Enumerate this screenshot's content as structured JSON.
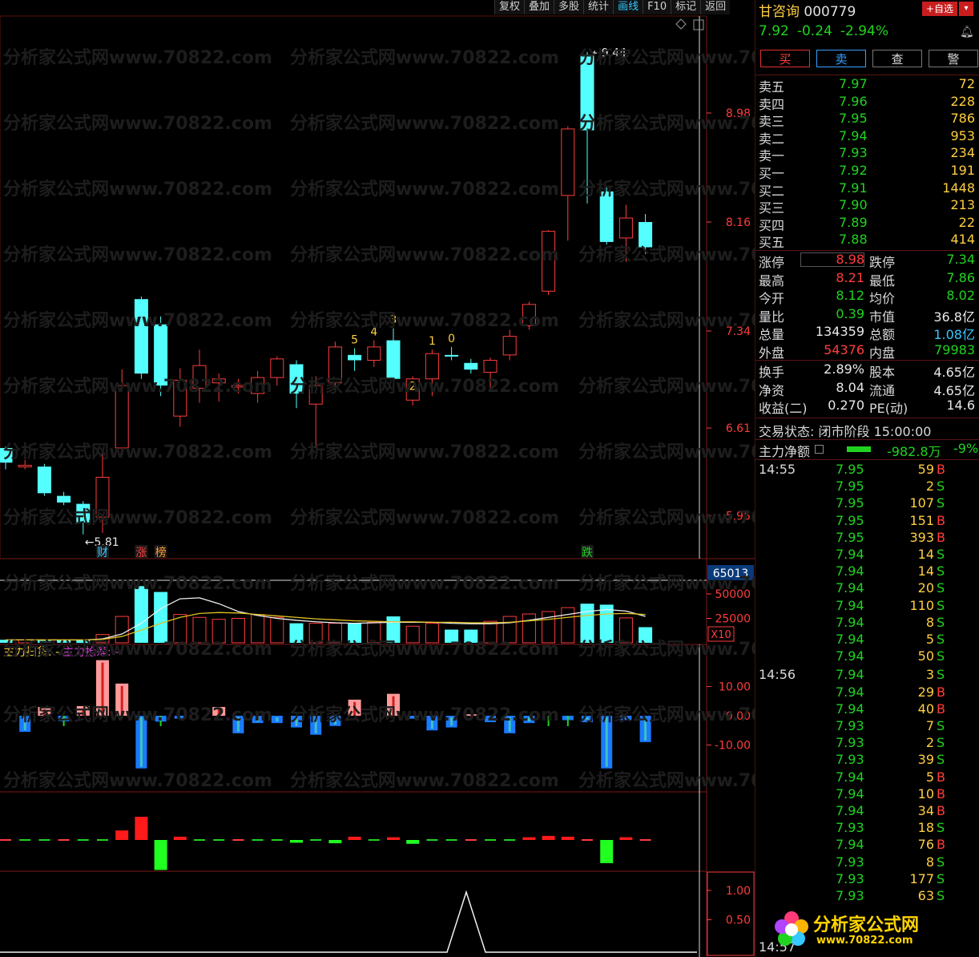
{
  "toolbar": [
    "复权",
    "叠加",
    "多股",
    "统计",
    "画线",
    "F10",
    "标记",
    "返回"
  ],
  "toolbar_active": "画线",
  "watermark": "分析家公式网www.70822.com",
  "chart": {
    "price_axis": [
      "8.98",
      "8.16",
      "7.34",
      "6.61",
      "5.95"
    ],
    "high_marker": "9.44",
    "low_marker": "5.81",
    "candles": [
      {
        "o": 6.46,
        "c": 6.35,
        "h": 6.47,
        "l": 6.3
      },
      {
        "o": 6.33,
        "c": 6.33,
        "h": 6.37,
        "l": 6.3
      },
      {
        "o": 6.32,
        "c": 6.12,
        "h": 6.34,
        "l": 6.1
      },
      {
        "o": 6.1,
        "c": 6.05,
        "h": 6.13,
        "l": 6.03
      },
      {
        "o": 6.04,
        "c": 5.9,
        "h": 6.06,
        "l": 5.81
      },
      {
        "o": 5.94,
        "c": 6.24,
        "h": 6.45,
        "l": 5.82
      },
      {
        "o": 6.46,
        "c": 6.93,
        "h": 7.05,
        "l": 6.4
      },
      {
        "o": 7.58,
        "c": 7.02,
        "h": 7.6,
        "l": 6.98
      },
      {
        "o": 7.39,
        "c": 6.93,
        "h": 7.45,
        "l": 6.85
      },
      {
        "o": 6.7,
        "c": 6.97,
        "h": 7.06,
        "l": 6.62
      },
      {
        "o": 6.91,
        "c": 7.08,
        "h": 7.2,
        "l": 6.8
      },
      {
        "o": 6.95,
        "c": 6.98,
        "h": 7.02,
        "l": 6.81
      },
      {
        "o": 6.92,
        "c": 6.93,
        "h": 6.98,
        "l": 6.87
      },
      {
        "o": 6.87,
        "c": 6.99,
        "h": 7.04,
        "l": 6.8
      },
      {
        "o": 6.99,
        "c": 7.13,
        "h": 7.15,
        "l": 6.93
      },
      {
        "o": 7.09,
        "c": 6.87,
        "h": 7.12,
        "l": 6.76
      },
      {
        "o": 6.79,
        "c": 6.93,
        "h": 7.0,
        "l": 6.46
      },
      {
        "o": 6.95,
        "c": 7.22,
        "h": 7.26,
        "l": 6.9
      },
      {
        "o": 7.16,
        "c": 7.12,
        "h": 7.21,
        "l": 7.04
      },
      {
        "o": 7.12,
        "c": 7.22,
        "h": 7.27,
        "l": 7.07
      },
      {
        "o": 7.27,
        "c": 6.98,
        "h": 7.36,
        "l": 6.91
      },
      {
        "o": 6.82,
        "c": 6.98,
        "h": 7.0,
        "l": 6.78
      },
      {
        "o": 6.98,
        "c": 7.17,
        "h": 7.2,
        "l": 6.85
      },
      {
        "o": 7.16,
        "c": 7.15,
        "h": 7.22,
        "l": 7.12
      },
      {
        "o": 7.1,
        "c": 7.05,
        "h": 7.13,
        "l": 7.02
      },
      {
        "o": 7.03,
        "c": 7.12,
        "h": 7.14,
        "l": 6.91
      },
      {
        "o": 7.16,
        "c": 7.3,
        "h": 7.35,
        "l": 7.12
      },
      {
        "o": 7.38,
        "c": 7.54,
        "h": 7.56,
        "l": 7.35
      },
      {
        "o": 7.64,
        "c": 8.09,
        "h": 8.1,
        "l": 7.61
      },
      {
        "o": 8.36,
        "c": 8.86,
        "h": 8.88,
        "l": 8.02
      },
      {
        "o": 9.42,
        "c": 8.85,
        "h": 9.44,
        "l": 8.3
      },
      {
        "o": 8.39,
        "c": 8.01,
        "h": 8.42,
        "l": 7.99
      },
      {
        "o": 8.04,
        "c": 8.19,
        "h": 8.29,
        "l": 7.86
      },
      {
        "o": 8.16,
        "c": 7.97,
        "h": 8.22,
        "l": 7.92
      }
    ],
    "number_labels": [
      {
        "i": 18,
        "t": "5"
      },
      {
        "i": 19,
        "t": "4"
      },
      {
        "i": 20,
        "t": "3"
      },
      {
        "i": 21,
        "t": "2"
      },
      {
        "i": 22,
        "t": "1"
      },
      {
        "i": 23,
        "t": "0"
      }
    ],
    "event_tags": [
      {
        "i": 5,
        "t": "财",
        "color": "#36c8ff"
      },
      {
        "i": 7,
        "t": "涨",
        "color": "#ff3c3c"
      },
      {
        "i": 8,
        "t": "榜",
        "color": "#ff9a30"
      },
      {
        "i": 30,
        "t": "跌",
        "color": "#21d321"
      }
    ],
    "volume_axis": [
      "50000",
      "25000"
    ],
    "volume_readout": "65013",
    "volume_scale": "X10",
    "volumes": [
      3100,
      3000,
      3000,
      2800,
      2900,
      8500,
      27000,
      58000,
      52000,
      29000,
      26000,
      24000,
      25000,
      29000,
      26000,
      20000,
      20000,
      20000,
      20000,
      21000,
      27000,
      17000,
      20000,
      13500,
      13500,
      22000,
      27000,
      29500,
      32000,
      36000,
      40000,
      39000,
      25500,
      16000
    ],
    "ma1": [
      3000,
      3000,
      3000,
      2900,
      2900,
      4000,
      9000,
      20000,
      35000,
      45000,
      46000,
      40000,
      32000,
      28000,
      25000,
      23000,
      21500,
      20500,
      20000,
      20500,
      21000,
      21000,
      21000,
      20000,
      19500,
      19500,
      20500,
      23000,
      26000,
      29000,
      32000,
      34000,
      32500,
      27000
    ],
    "ma2": [
      3000,
      3000,
      3000,
      3000,
      3000,
      3500,
      6500,
      13000,
      20000,
      26000,
      30000,
      31000,
      30500,
      29000,
      27500,
      26000,
      24500,
      23500,
      22500,
      22000,
      21500,
      21500,
      21000,
      21000,
      20500,
      20500,
      21000,
      22500,
      24000,
      26000,
      28000,
      29500,
      30000,
      29000
    ],
    "indicator_title_1": "主力扫货: -",
    "indicator_title_2": "主力抢筹: -",
    "indicator_axis": [
      "10.00",
      "0.00",
      "-10.00"
    ],
    "indicator": [
      3.3,
      0,
      -5.5,
      3,
      -1.9,
      3.3,
      19,
      11,
      -18,
      -2,
      -1,
      0,
      3,
      -6,
      -2.5,
      -2.5,
      -4,
      -6.5,
      -3.5,
      5.5,
      0,
      7.5,
      -1,
      -5,
      -4,
      0.5,
      -2.2,
      -6,
      -2.5,
      0,
      -1.5,
      -2.2,
      -18,
      -1.5,
      -9
    ],
    "bars4": [
      0,
      0,
      0,
      0,
      0,
      0,
      0.35,
      0.85,
      -1.1,
      0.12,
      0,
      0,
      0,
      0,
      0,
      -0.1,
      0,
      -0.12,
      0.12,
      0,
      0.1,
      -0.14,
      0,
      0,
      0,
      0,
      0,
      0.1,
      0.15,
      0.12,
      0,
      -0.85,
      0.1,
      0
    ],
    "bottom_axis": [
      "1.00",
      "0.50"
    ]
  },
  "panel": {
    "name": "甘咨询",
    "code": "000779",
    "fav_label": "+自选",
    "fav_drop": "▾",
    "price": "7.92",
    "change": "-0.24",
    "change_pct": "-2.94%",
    "actions": [
      "买",
      "卖",
      "查",
      "警"
    ],
    "asks": [
      {
        "l": "卖五",
        "p": "7.97",
        "v": "72"
      },
      {
        "l": "卖四",
        "p": "7.96",
        "v": "228"
      },
      {
        "l": "卖三",
        "p": "7.95",
        "v": "786"
      },
      {
        "l": "卖二",
        "p": "7.94",
        "v": "953"
      },
      {
        "l": "卖一",
        "p": "7.93",
        "v": "234"
      }
    ],
    "bids": [
      {
        "l": "买一",
        "p": "7.92",
        "v": "191"
      },
      {
        "l": "买二",
        "p": "7.91",
        "v": "1448"
      },
      {
        "l": "买三",
        "p": "7.90",
        "v": "213"
      },
      {
        "l": "买四",
        "p": "7.89",
        "v": "22"
      },
      {
        "l": "买五",
        "p": "7.88",
        "v": "414"
      }
    ],
    "stats": [
      {
        "a": "涨停",
        "b": "8.98",
        "bc": "red",
        "c": "跌停",
        "d": "7.34",
        "dc": "green"
      },
      {
        "a": "最高",
        "b": "8.21",
        "bc": "red",
        "c": "最低",
        "d": "7.86",
        "dc": "green"
      },
      {
        "a": "今开",
        "b": "8.12",
        "bc": "green",
        "c": "均价",
        "d": "8.02",
        "dc": "green"
      },
      {
        "a": "量比",
        "b": "0.39",
        "bc": "green",
        "c": "市值",
        "d": "36.8亿",
        "dc": "white"
      },
      {
        "a": "总量",
        "b": "134359",
        "bc": "white",
        "c": "总额",
        "d": "1.08亿",
        "dc": "cyan"
      },
      {
        "a": "外盘",
        "b": "54376",
        "bc": "red",
        "c": "内盘",
        "d": "79983",
        "dc": "green"
      }
    ],
    "stats2": [
      {
        "a": "换手",
        "b": "2.89%",
        "c": "股本",
        "d": "4.65亿"
      },
      {
        "a": "净资",
        "b": "8.04",
        "c": "流通",
        "d": "4.65亿"
      },
      {
        "a": "收益(二)",
        "b": "0.270",
        "c": "PE(动)",
        "d": "14.6"
      }
    ],
    "trade_status": "交易状态: 闭市阶段 15:00:00",
    "net_flow_label": "主力净额",
    "net_flow_value": "-982.8万",
    "net_flow_pct": "-9%",
    "tick_groups": [
      {
        "time": "14:55",
        "rows": [
          [
            "7.95",
            "59",
            "B"
          ],
          [
            "7.95",
            "2",
            "S"
          ],
          [
            "7.95",
            "107",
            "S"
          ],
          [
            "7.95",
            "151",
            "B"
          ],
          [
            "7.95",
            "393",
            "B"
          ],
          [
            "7.94",
            "14",
            "S"
          ],
          [
            "7.94",
            "14",
            "S"
          ],
          [
            "7.94",
            "20",
            "S"
          ],
          [
            "7.94",
            "110",
            "S"
          ],
          [
            "7.94",
            "8",
            "S"
          ],
          [
            "7.94",
            "5",
            "S"
          ],
          [
            "7.94",
            "50",
            "S"
          ]
        ]
      },
      {
        "time": "14:56",
        "rows": [
          [
            "7.94",
            "3",
            "S"
          ],
          [
            "7.94",
            "29",
            "B"
          ],
          [
            "7.94",
            "40",
            "B"
          ],
          [
            "7.93",
            "7",
            "S"
          ],
          [
            "7.93",
            "2",
            "S"
          ],
          [
            "7.93",
            "39",
            "S"
          ],
          [
            "7.94",
            "5",
            "B"
          ],
          [
            "7.94",
            "10",
            "B"
          ],
          [
            "7.94",
            "34",
            "B"
          ],
          [
            "7.93",
            "18",
            "S"
          ],
          [
            "7.94",
            "76",
            "B"
          ],
          [
            "7.93",
            "8",
            "S"
          ],
          [
            "7.93",
            "177",
            "S"
          ],
          [
            "7.93",
            "63",
            "S"
          ]
        ]
      },
      {
        "time": "14:57",
        "rows": []
      }
    ],
    "logo_text": "分析家公式网",
    "logo_url": "www.70822.com"
  }
}
